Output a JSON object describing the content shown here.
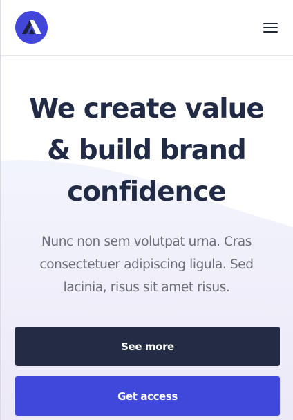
{
  "header": {
    "logo_icon": "triangle-logo-icon",
    "menu_icon": "hamburger-menu-icon"
  },
  "hero": {
    "title_line1": "We create value",
    "title_line2": "& build brand",
    "title_line3": "confidence",
    "text_line1": "Nunc non sem volutpat urna. Cras",
    "text_line2": "consectetuer adipiscing ligula. Sed",
    "text_line3": "lacinia, risus sit amet risus."
  },
  "actions": {
    "see_more_label": "See more",
    "get_access_label": "Get access"
  },
  "colors": {
    "brand_blue": "#3f48da",
    "navy": "#232b45",
    "text_gray": "#6b6e78",
    "background_tint": "#eef0fb"
  }
}
